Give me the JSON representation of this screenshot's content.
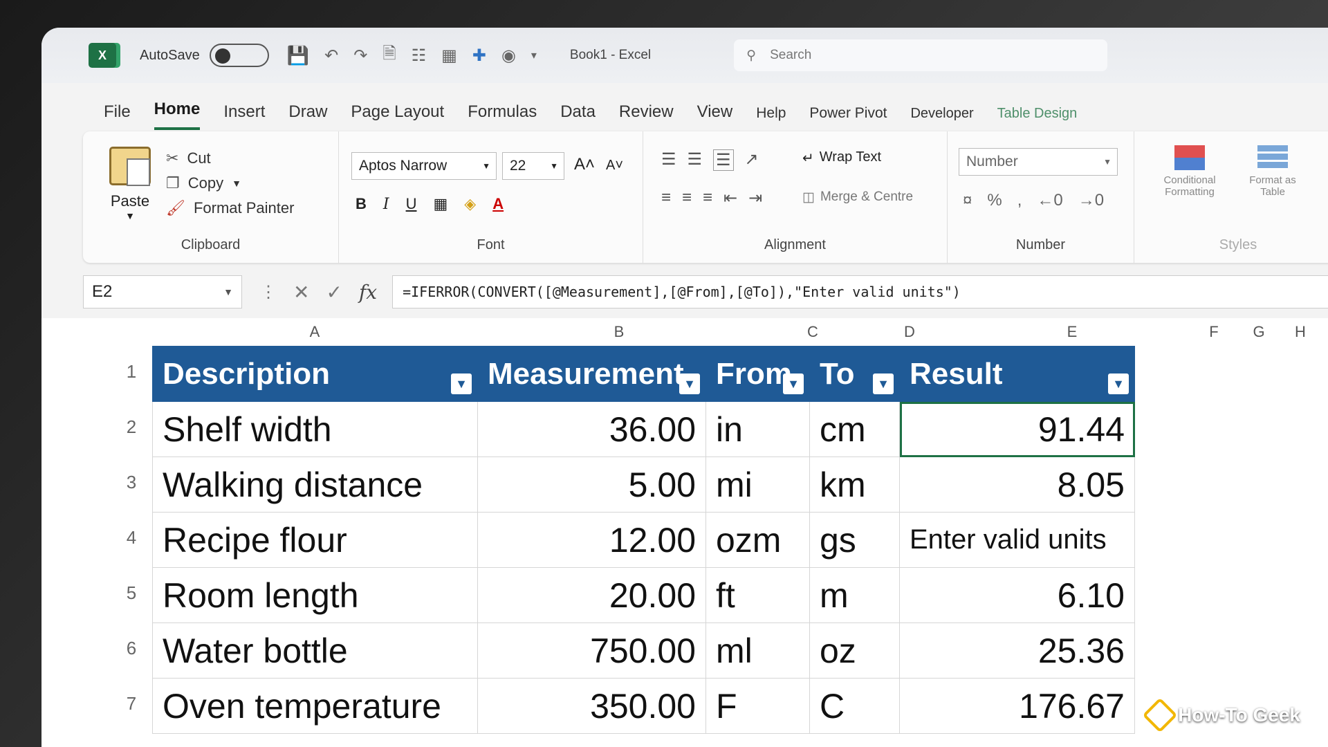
{
  "app": {
    "autosave_label": "AutoSave",
    "doc_title": "Book1  -  Excel",
    "search_placeholder": "Search"
  },
  "tabs": [
    {
      "label": "File"
    },
    {
      "label": "Home"
    },
    {
      "label": "Insert"
    },
    {
      "label": "Draw"
    },
    {
      "label": "Page Layout"
    },
    {
      "label": "Formulas"
    },
    {
      "label": "Data"
    },
    {
      "label": "Review"
    },
    {
      "label": "View"
    },
    {
      "label": "Help"
    },
    {
      "label": "Power Pivot"
    },
    {
      "label": "Developer"
    },
    {
      "label": "Table Design"
    }
  ],
  "ribbon": {
    "clipboard": {
      "paste": "Paste",
      "cut": "Cut",
      "copy": "Copy",
      "format_painter": "Format Painter",
      "label": "Clipboard"
    },
    "font": {
      "font_name": "Aptos Narrow",
      "font_size": "22",
      "label": "Font"
    },
    "alignment": {
      "wrap_text": "Wrap Text",
      "merge_centre": "Merge & Centre",
      "label": "Alignment"
    },
    "number": {
      "format": "Number",
      "label": "Number"
    },
    "styles": {
      "conditional": "Conditional Formatting",
      "format_table": "Format as Table",
      "label": "Styles"
    }
  },
  "formula_bar": {
    "name_box": "E2",
    "formula": "=IFERROR(CONVERT([@Measurement],[@From],[@To]),\"Enter valid units\")"
  },
  "columns": [
    "A",
    "B",
    "C",
    "D",
    "E",
    "F",
    "G",
    "H"
  ],
  "rows": [
    "1",
    "2",
    "3",
    "4",
    "5",
    "6",
    "7"
  ],
  "table": {
    "headers": {
      "description": "Description",
      "measurement": "Measurement",
      "from": "From",
      "to": "To",
      "result": "Result"
    },
    "records": [
      {
        "description": "Shelf width",
        "measurement": "36.00",
        "from": "in",
        "to": "cm",
        "result": "91.44"
      },
      {
        "description": "Walking distance",
        "measurement": "5.00",
        "from": "mi",
        "to": "km",
        "result": "8.05"
      },
      {
        "description": "Recipe flour",
        "measurement": "12.00",
        "from": "ozm",
        "to": "gs",
        "result": "Enter valid units"
      },
      {
        "description": "Room length",
        "measurement": "20.00",
        "from": "ft",
        "to": "m",
        "result": "6.10"
      },
      {
        "description": "Water bottle",
        "measurement": "750.00",
        "from": "ml",
        "to": "oz",
        "result": "25.36"
      },
      {
        "description": "Oven temperature",
        "measurement": "350.00",
        "from": "F",
        "to": "C",
        "result": "176.67"
      }
    ]
  },
  "watermark": "How-To Geek",
  "colors": {
    "header_blue": "#1f5a96",
    "excel_green": "#1e7145"
  }
}
